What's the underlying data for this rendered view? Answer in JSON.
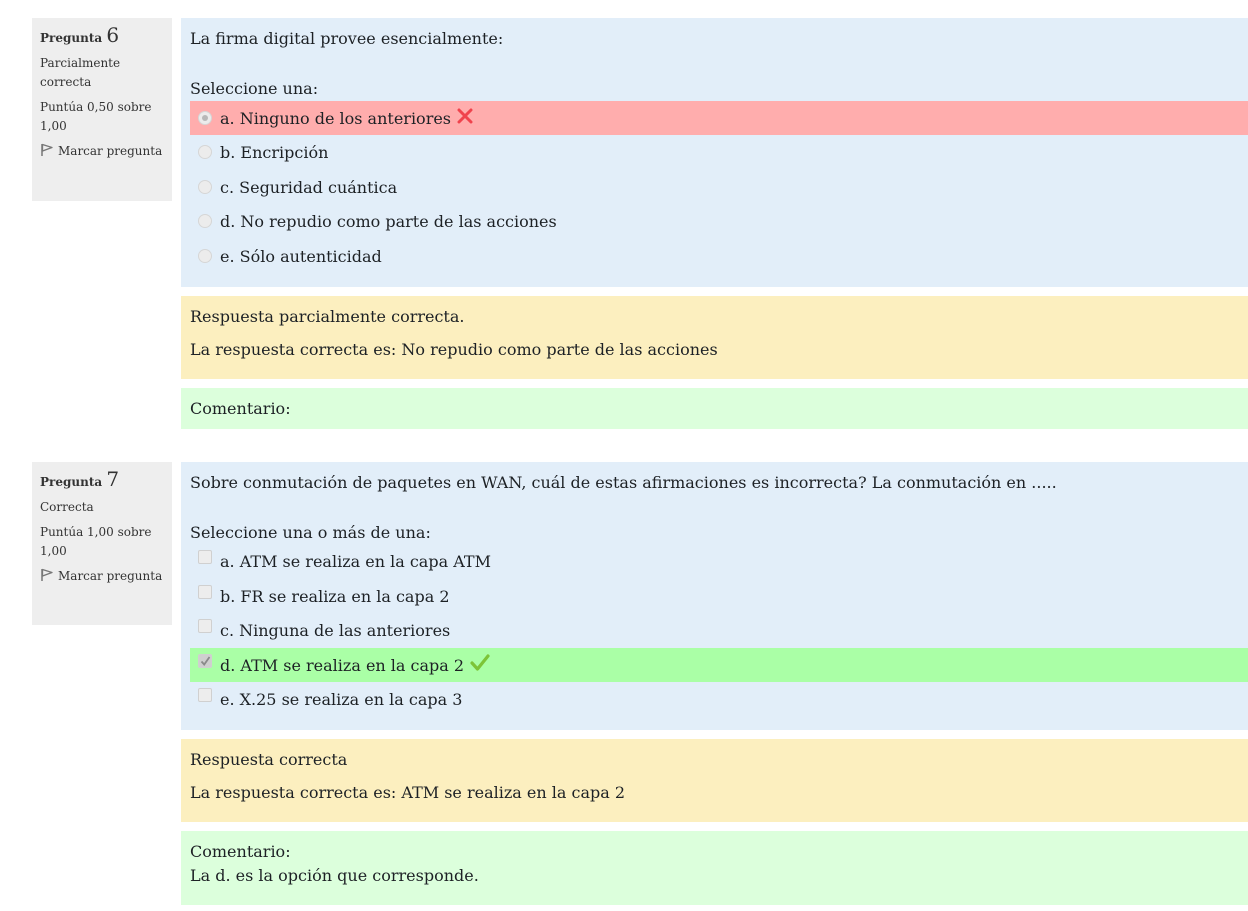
{
  "questions": [
    {
      "label": "Pregunta",
      "number": "6",
      "state": "Parcialmente correcta",
      "grade": "Puntúa 0,50 sobre 1,00",
      "flag_label": "Marcar pregunta",
      "text": "La firma digital provee esencialmente:",
      "prompt": "Seleccione una:",
      "input_type": "radio",
      "answers": [
        {
          "label": "a. Ninguno de los anteriores",
          "checked": true,
          "status": "incorrect"
        },
        {
          "label": "b. Encripción",
          "checked": false,
          "status": ""
        },
        {
          "label": "c. Seguridad cuántica",
          "checked": false,
          "status": ""
        },
        {
          "label": "d. No repudio como parte de las acciones",
          "checked": false,
          "status": ""
        },
        {
          "label": "e. Sólo autenticidad",
          "checked": false,
          "status": ""
        }
      ],
      "feedback": {
        "general": "Respuesta parcialmente correcta.",
        "right_answer": "La respuesta correcta es: No repudio como parte de las acciones"
      },
      "comment": {
        "label": "Comentario:",
        "text": ""
      }
    },
    {
      "label": "Pregunta",
      "number": "7",
      "state": "Correcta",
      "grade": "Puntúa 1,00 sobre 1,00",
      "flag_label": "Marcar pregunta",
      "text": "Sobre conmutación de paquetes en WAN, cuál de estas afirmaciones es incorrecta? La conmutación en .....",
      "prompt": "Seleccione una o más de una:",
      "input_type": "checkbox",
      "answers": [
        {
          "label": "a. ATM se realiza en la capa ATM",
          "checked": false,
          "status": ""
        },
        {
          "label": "b. FR se realiza en la capa 2",
          "checked": false,
          "status": ""
        },
        {
          "label": "c. Ninguna de las anteriores",
          "checked": false,
          "status": ""
        },
        {
          "label": "d. ATM se realiza en la capa 2",
          "checked": true,
          "status": "correct"
        },
        {
          "label": "e. X.25 se realiza en la capa 3",
          "checked": false,
          "status": ""
        }
      ],
      "feedback": {
        "general": "Respuesta correcta",
        "right_answer": "La respuesta correcta es: ATM se realiza en la capa 2"
      },
      "comment": {
        "label": "Comentario:",
        "text": "La d. es la opción que corresponde."
      }
    }
  ],
  "colors": {
    "info_bg": "#eeeeee",
    "formulation_bg": "#e2eef9",
    "incorrect_bg": "#ffadad",
    "correct_bg": "#aaffa6",
    "feedback_bg": "#fcefbf",
    "comment_bg": "#dcffdc",
    "incorrect_icon": "#f0434d",
    "correct_icon": "#7dc438"
  }
}
